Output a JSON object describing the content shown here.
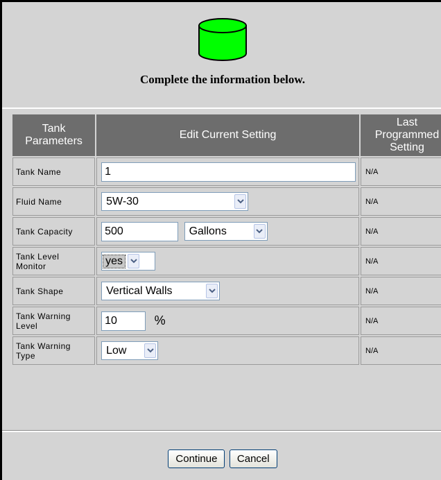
{
  "tank_icon": {
    "icon": "green-cylinder-tank-icon",
    "fill": "#00ff00",
    "stroke": "#000000"
  },
  "heading": "Complete the information below.",
  "table": {
    "headers": {
      "parameters": "Tank\nParameters",
      "edit": "Edit Current Setting",
      "last": "Last\nProgrammed\nSetting"
    },
    "header_bg": "#6d6d6d",
    "rows": [
      {
        "label": "Tank Name",
        "value": "1",
        "last": "N/A"
      },
      {
        "label": "Fluid Name",
        "value": "5W-30",
        "last": "N/A"
      },
      {
        "label": "Tank Capacity",
        "value": "500",
        "unit": "Gallons",
        "last": "N/A"
      },
      {
        "label": "Tank Level\nMonitor",
        "value": "yes",
        "last": "N/A"
      },
      {
        "label": "Tank Shape",
        "value": "Vertical Walls",
        "last": "N/A"
      },
      {
        "label": "Tank Warning\nLevel",
        "value": "10",
        "unit": "%",
        "last": "N/A"
      },
      {
        "label": "Tank Warning\nType",
        "value": "Low",
        "last": "N/A"
      }
    ]
  },
  "buttons": {
    "continue": "Continue",
    "cancel": "Cancel"
  }
}
